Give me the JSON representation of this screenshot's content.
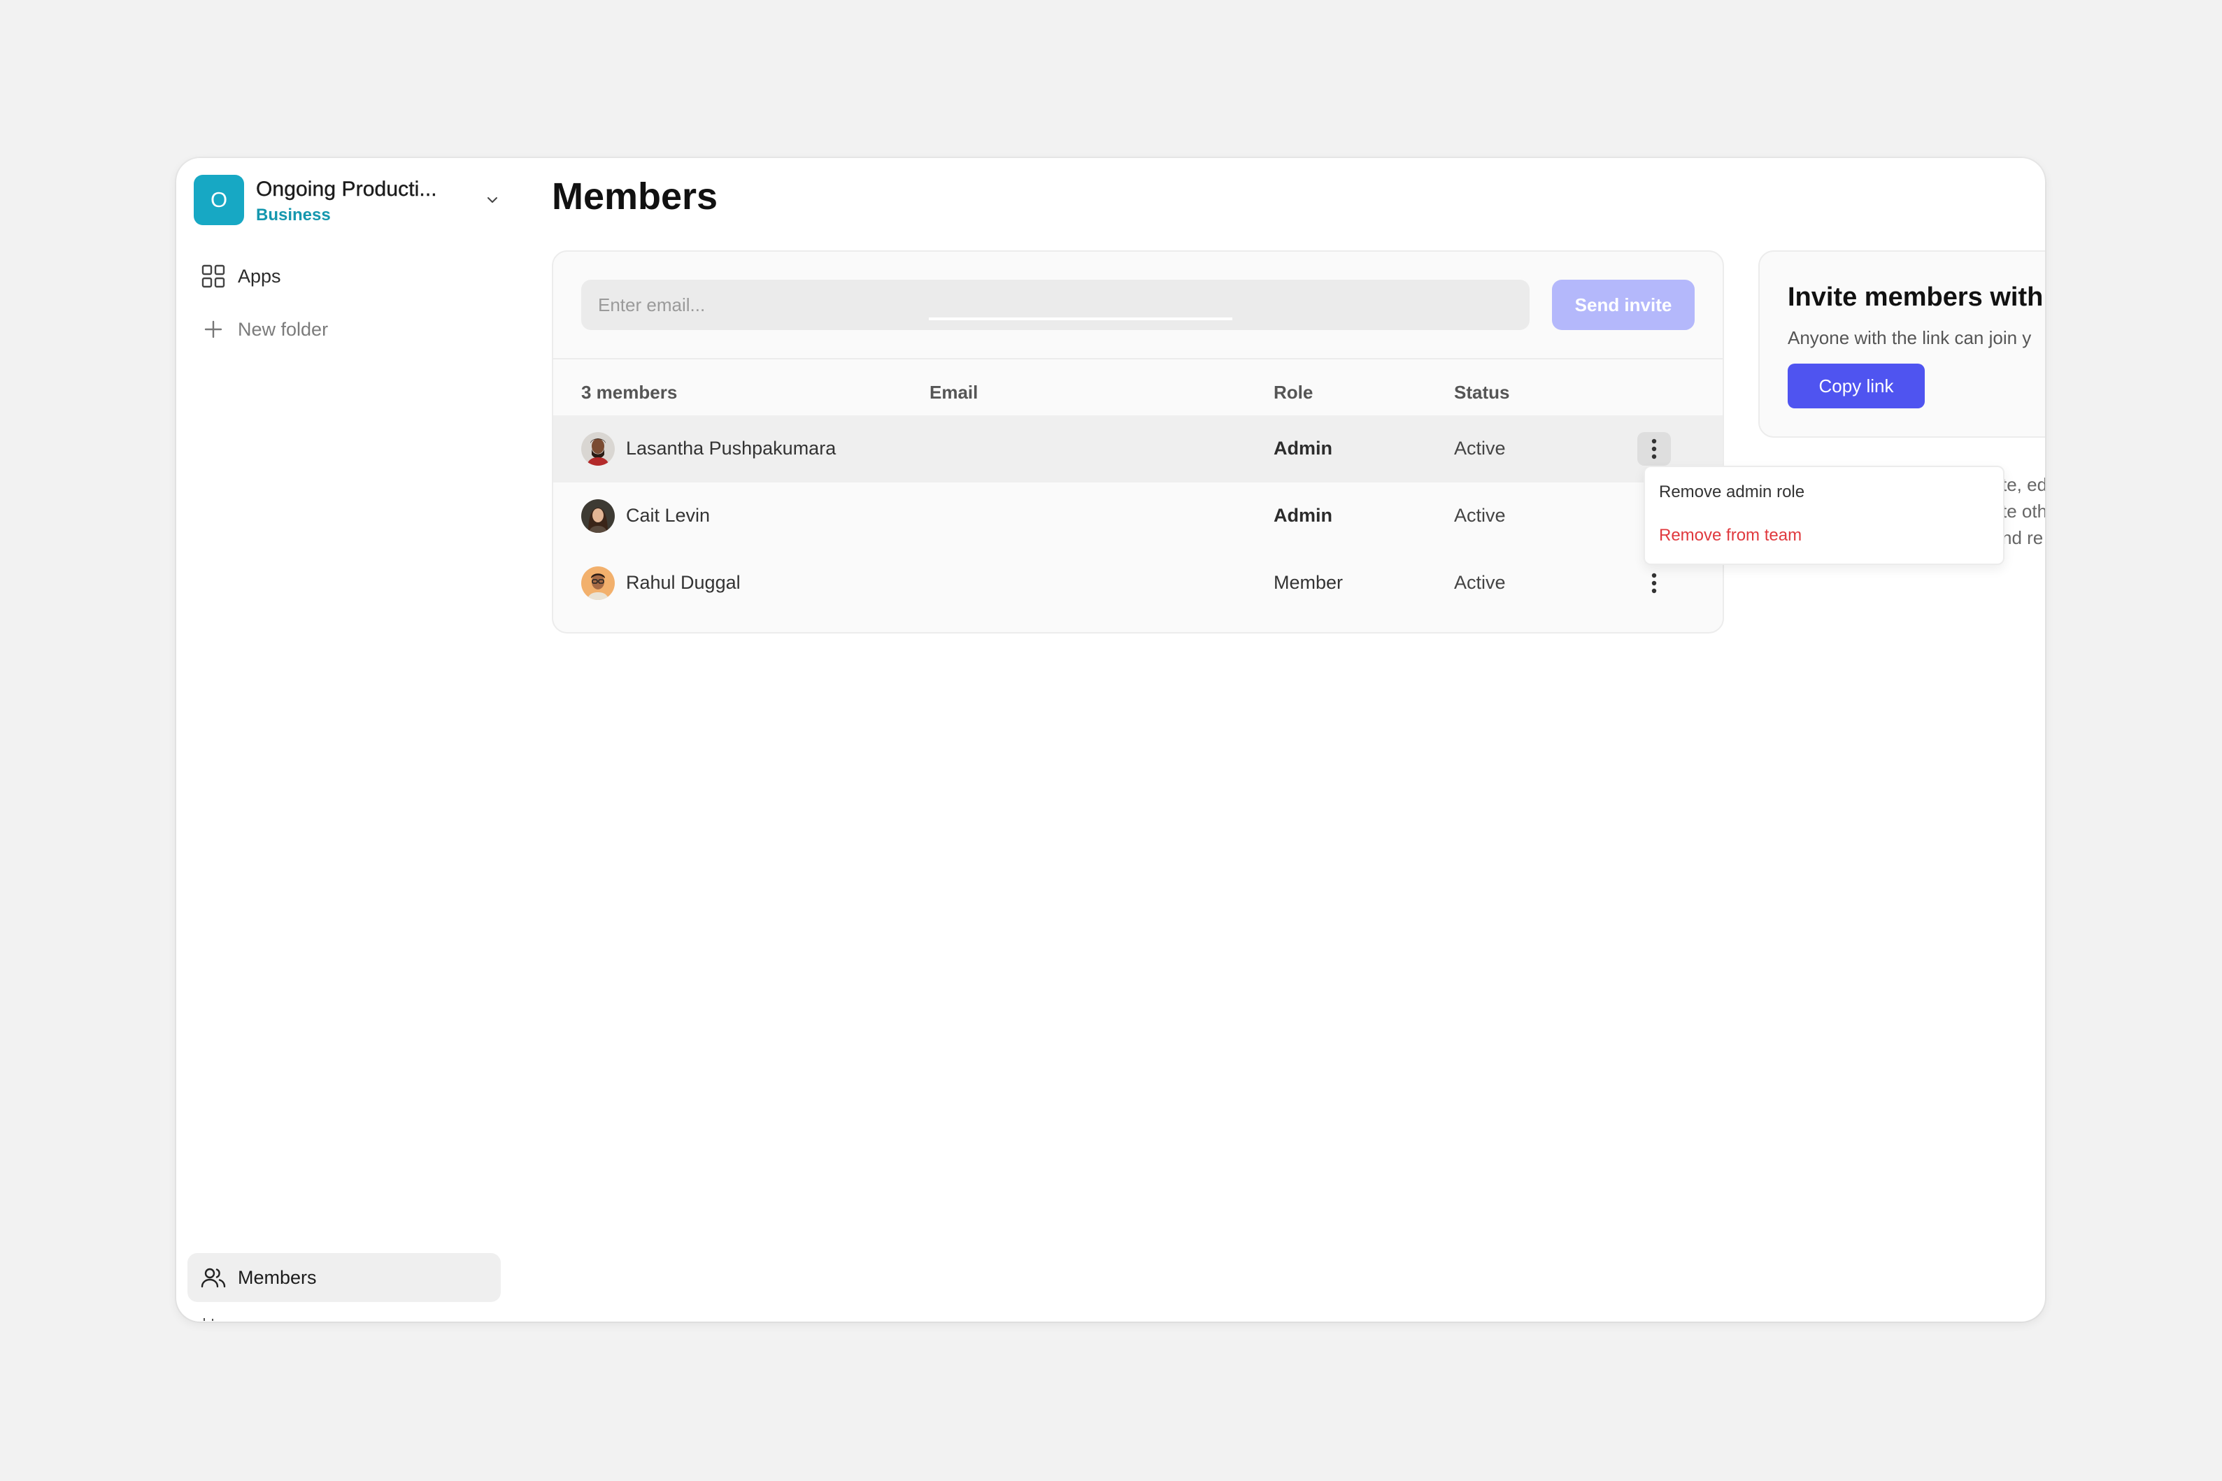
{
  "workspace": {
    "initial": "O",
    "name": "Ongoing Producti...",
    "plan": "Business",
    "avatar_color": "#17a8c4"
  },
  "sidebar": {
    "items": [
      {
        "label": "Apps",
        "icon": "grid-icon"
      },
      {
        "label": "New folder",
        "icon": "plus-icon"
      }
    ],
    "bottom_item": {
      "label": "Members",
      "icon": "users-icon"
    }
  },
  "main": {
    "title": "Members",
    "invite": {
      "placeholder": "Enter email...",
      "send_label": "Send invite"
    },
    "table": {
      "headers": {
        "count": "3 members",
        "email": "Email",
        "role": "Role",
        "status": "Status"
      },
      "rows": [
        {
          "name": "Lasantha Pushpakumara",
          "email": "",
          "role": "Admin",
          "status": "Active"
        },
        {
          "name": "Cait Levin",
          "email": "",
          "role": "Admin",
          "status": "Active"
        },
        {
          "name": "Rahul Duggal",
          "email": "",
          "role": "Member",
          "status": "Active"
        }
      ]
    }
  },
  "invite_link_card": {
    "title": "Invite members with",
    "text": "Anyone with the link can join y",
    "copy_label": "Copy link",
    "peek_lines": [
      "te, ed",
      "te oth",
      "nd re"
    ]
  },
  "row_menu": {
    "items": [
      {
        "label": "Remove admin role"
      },
      {
        "label": "Remove from team"
      }
    ]
  },
  "colors": {
    "accent": "#4f54f0",
    "accent_disabled": "#b4b8fb",
    "danger": "#e0393e",
    "brand_teal": "#17a8c4"
  }
}
